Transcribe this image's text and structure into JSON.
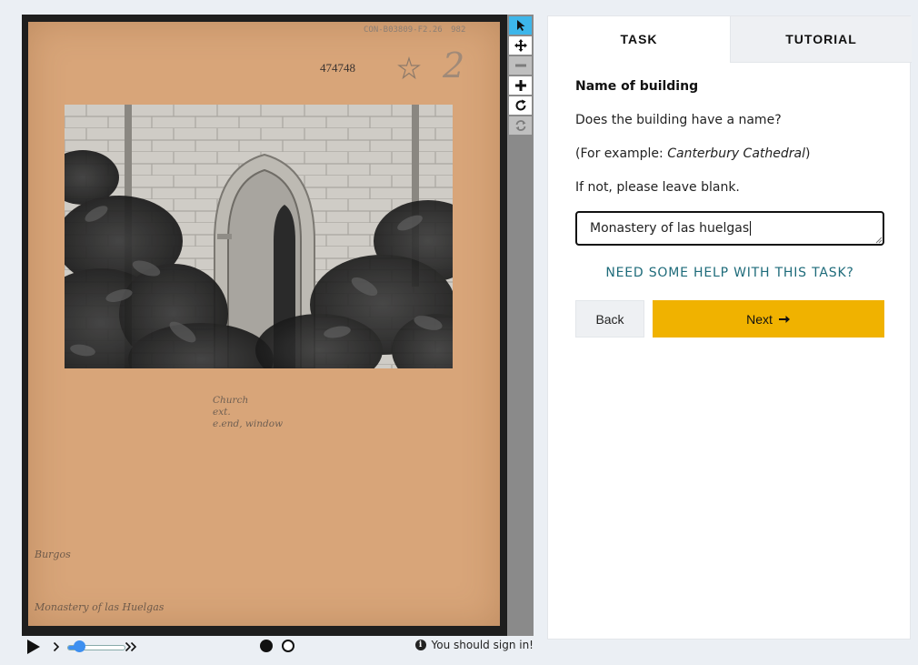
{
  "subject": {
    "catalog_number": "CON-B03809-F2.26",
    "catalog_suffix": "982",
    "accession_number": "474748",
    "box_number": "2",
    "notes": [
      "Church",
      "ext.",
      "e.end, window"
    ],
    "location_city": "Burgos",
    "location_building": "Monastery of las Huelgas"
  },
  "viewer": {
    "tools": [
      {
        "name": "annotate",
        "icon": "pointer-icon",
        "active": true
      },
      {
        "name": "move",
        "icon": "move-arrows-icon",
        "active": false
      },
      {
        "name": "zoom-out",
        "icon": "minus-icon",
        "disabled": true
      },
      {
        "name": "zoom-in",
        "icon": "plus-icon",
        "active": false
      },
      {
        "name": "rotate",
        "icon": "rotate-icon",
        "active": false
      },
      {
        "name": "reset",
        "icon": "reset-icon",
        "disabled": true
      }
    ],
    "controls": {
      "play_icon": "play-icon",
      "slower_icon": "chevron-right-icon",
      "faster_icon": "double-chevron-right-icon",
      "speed_fraction": 0.15,
      "frames": [
        {
          "filled": true
        },
        {
          "filled": false
        }
      ],
      "signin_text": "You should sign in!"
    },
    "accent_color": "#3db6ea"
  },
  "tabs": {
    "task": "TASK",
    "tutorial": "TUTORIAL"
  },
  "task": {
    "title": "Name of building",
    "question": "Does the building have a name?",
    "example_prefix": "(For example: ",
    "example": "Canterbury Cathedral",
    "example_suffix": ")",
    "instruction": "If not, please leave blank.",
    "answer_value": "Monastery of las huelgas",
    "help_link": "NEED SOME HELP WITH THIS TASK?",
    "back_label": "Back",
    "next_label": "Next",
    "next_icon": "arrow-right-icon",
    "next_color": "#f0b200"
  }
}
